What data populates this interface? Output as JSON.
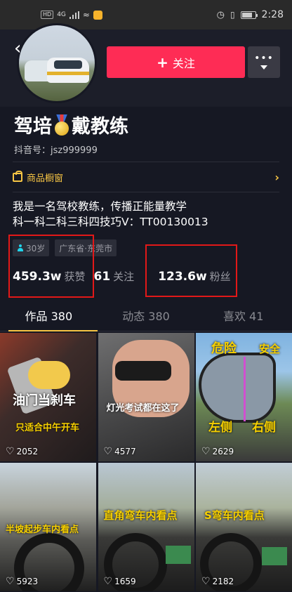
{
  "status_bar": {
    "network": "4G",
    "hd": "HD",
    "time": "2:28"
  },
  "profile": {
    "name_part1": "驾培",
    "name_part2": "戴教练",
    "douyin_id": "抖音号：jsz999999",
    "follow_label": "关注",
    "shop_label": "商品橱窗",
    "bio_line1": "我是一名驾校教练，传播正能量教学",
    "bio_line2": "科一科二科三科四技巧V：TT00130013",
    "tag_age": "30岁",
    "tag_location": "广东省·东莞市",
    "likes_value": "459.3w",
    "likes_label": "获赞",
    "following_value": "61",
    "following_label": "关注",
    "fans_value": "123.6w",
    "fans_label": "粉丝"
  },
  "tabs": [
    {
      "label": "作品 380"
    },
    {
      "label": "动态 380"
    },
    {
      "label": "喜欢 41"
    }
  ],
  "videos": [
    {
      "caption": "油门当刹车",
      "caption2": "只适合中午开车",
      "likes": "2052"
    },
    {
      "caption": "灯光考试都在这了",
      "likes": "4577"
    },
    {
      "caption": "危险",
      "caption_b": "安全",
      "caption2": "左侧",
      "caption2_b": "右侧",
      "likes": "2629"
    },
    {
      "caption": "半坡起步车内看点",
      "likes": "5923"
    },
    {
      "caption": "直角弯车内看点",
      "likes": "1659"
    },
    {
      "caption": "S弯车内看点",
      "likes": "2182"
    }
  ],
  "colors": {
    "accent": "#fe2c55",
    "highlight_box": "#e21818",
    "shop": "#f7c544",
    "background": "#161823"
  }
}
